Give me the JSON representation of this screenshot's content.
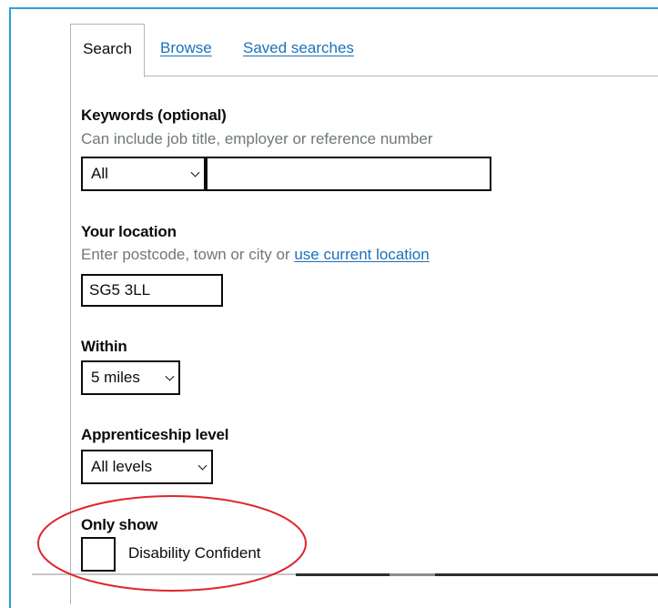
{
  "tabs": [
    {
      "label": "Search",
      "active": true
    },
    {
      "label": "Browse",
      "active": false
    },
    {
      "label": "Saved searches",
      "active": false
    }
  ],
  "keywords": {
    "label": "Keywords (optional)",
    "hint": "Can include job title, employer or reference number",
    "scope_selected": "All",
    "value": ""
  },
  "location": {
    "label": "Your location",
    "hint_prefix": "Enter postcode, town or city or ",
    "hint_link": "use current location",
    "value": "SG5 3LL"
  },
  "within": {
    "label": "Within",
    "selected": "5 miles"
  },
  "level": {
    "label": "Apprenticeship level",
    "selected": "All levels"
  },
  "only_show": {
    "label": "Only show",
    "option_label": "Disability Confident",
    "checked": false
  },
  "colors": {
    "frame_border": "#2d9fd8",
    "link": "#1d70b8",
    "annotation": "#e0242a",
    "text": "#0b0c0c",
    "hint": "#6f777b"
  },
  "icons": {
    "select_caret": "chevron-down-icon"
  }
}
